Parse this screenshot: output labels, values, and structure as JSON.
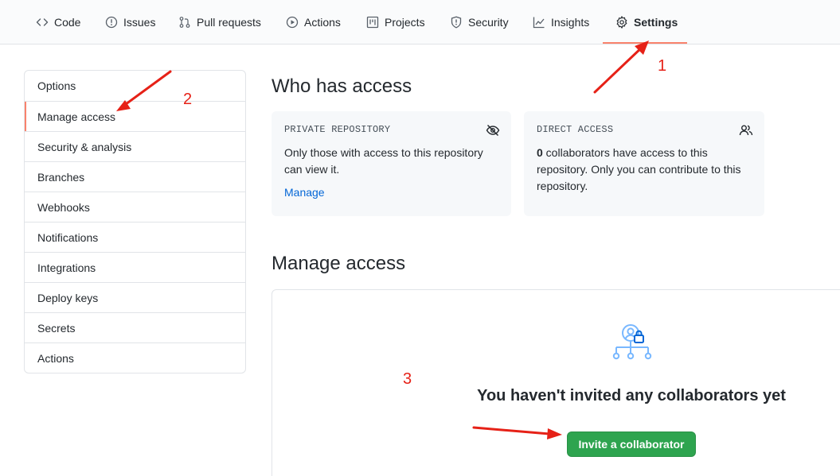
{
  "nav": {
    "tabs": [
      {
        "label": "Code",
        "icon": "code-icon"
      },
      {
        "label": "Issues",
        "icon": "issue-icon"
      },
      {
        "label": "Pull requests",
        "icon": "pull-request-icon"
      },
      {
        "label": "Actions",
        "icon": "play-icon"
      },
      {
        "label": "Projects",
        "icon": "project-icon"
      },
      {
        "label": "Security",
        "icon": "shield-icon"
      },
      {
        "label": "Insights",
        "icon": "graph-icon"
      },
      {
        "label": "Settings",
        "icon": "gear-icon",
        "selected": true
      }
    ]
  },
  "sidebar": {
    "items": [
      {
        "label": "Options"
      },
      {
        "label": "Manage access",
        "active": true
      },
      {
        "label": "Security & analysis"
      },
      {
        "label": "Branches"
      },
      {
        "label": "Webhooks"
      },
      {
        "label": "Notifications"
      },
      {
        "label": "Integrations"
      },
      {
        "label": "Deploy keys"
      },
      {
        "label": "Secrets"
      },
      {
        "label": "Actions"
      }
    ]
  },
  "who_has_access": {
    "title": "Who has access",
    "private_card": {
      "label": "PRIVATE REPOSITORY",
      "text": "Only those with access to this repository can view it.",
      "link": "Manage",
      "icon": "eye-closed-icon"
    },
    "direct_card": {
      "label": "DIRECT ACCESS",
      "count": "0",
      "text": " collaborators have access to this repository. Only you can contribute to this repository.",
      "icon": "people-icon"
    }
  },
  "manage_access": {
    "title": "Manage access",
    "empty_text": "You haven't invited any collaborators yet",
    "invite_button": "Invite a collaborator",
    "icon": "org-lock-icon"
  },
  "annotations": {
    "n1": "1",
    "n2": "2",
    "n3": "3",
    "color": "#e62117"
  },
  "colors": {
    "accent_underline": "#f9826c",
    "link": "#0366d6",
    "button_green": "#2ea44f"
  }
}
